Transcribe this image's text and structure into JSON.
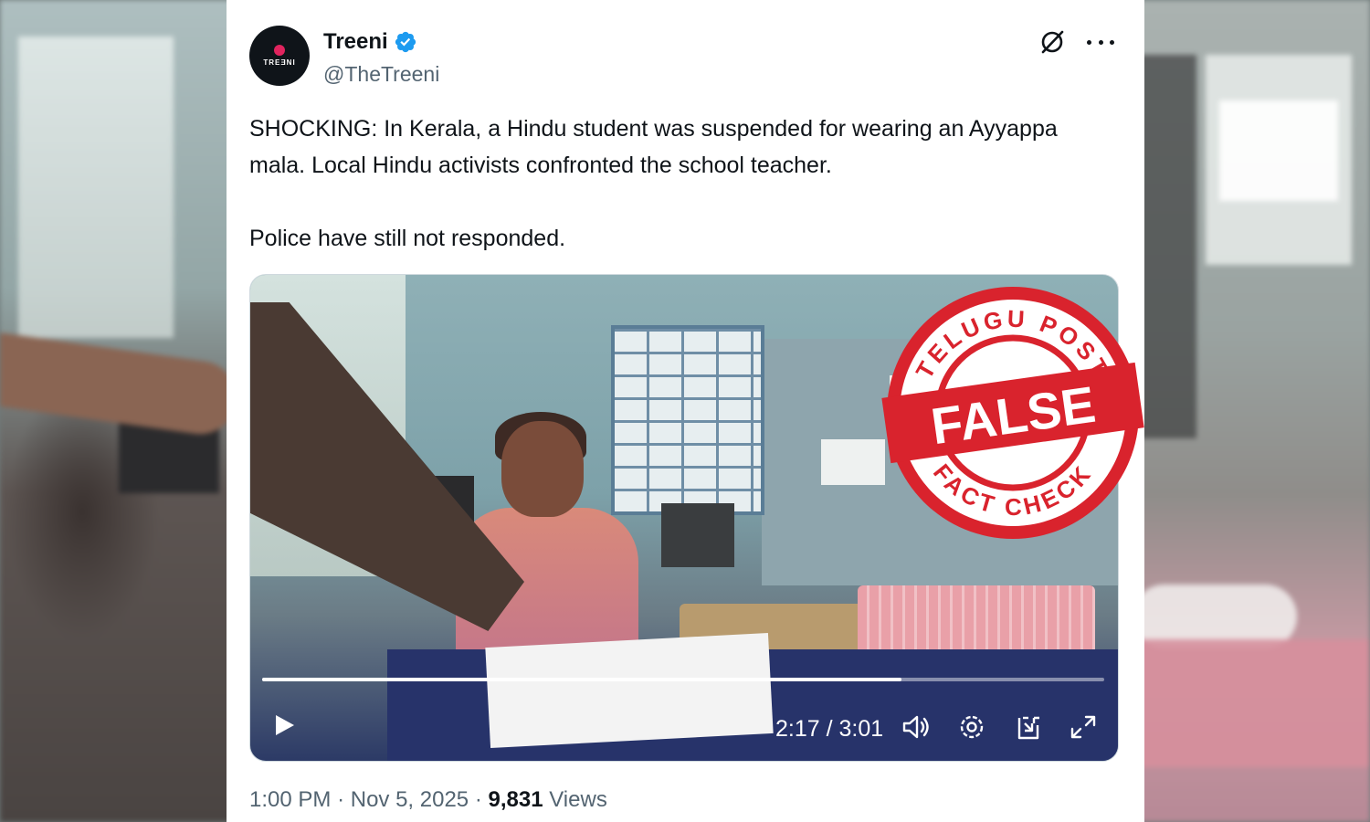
{
  "tweet": {
    "display_name": "Treeni",
    "handle": "@TheTreeni",
    "avatar_text": "TREƎNI",
    "text_p1": "SHOCKING: In Kerala, a Hindu student was suspended for wearing an Ayyappa mala. Local Hindu activists confronted the school teacher.",
    "text_p2": "Police have still not responded.",
    "time": "1:00 PM",
    "separator": "·",
    "date": "Nov 5, 2025",
    "views_count": "9,831",
    "views_label": "Views"
  },
  "video": {
    "current_time": "2:17",
    "duration": "3:01",
    "time_display": "2:17 / 3:01",
    "progress_fraction": 0.759
  },
  "stamp": {
    "top_text": "TELUGU POST",
    "verdict": "FALSE",
    "bottom_text": "FACT CHECK",
    "color": "#d9232d"
  },
  "colors": {
    "verified": "#1d9bf0",
    "text": "#0f1419",
    "muted": "#536471"
  },
  "icons": [
    "verified-badge-icon",
    "grok-icon",
    "more-icon",
    "play-icon",
    "volume-icon",
    "settings-icon",
    "picture-in-picture-icon",
    "fullscreen-icon"
  ]
}
